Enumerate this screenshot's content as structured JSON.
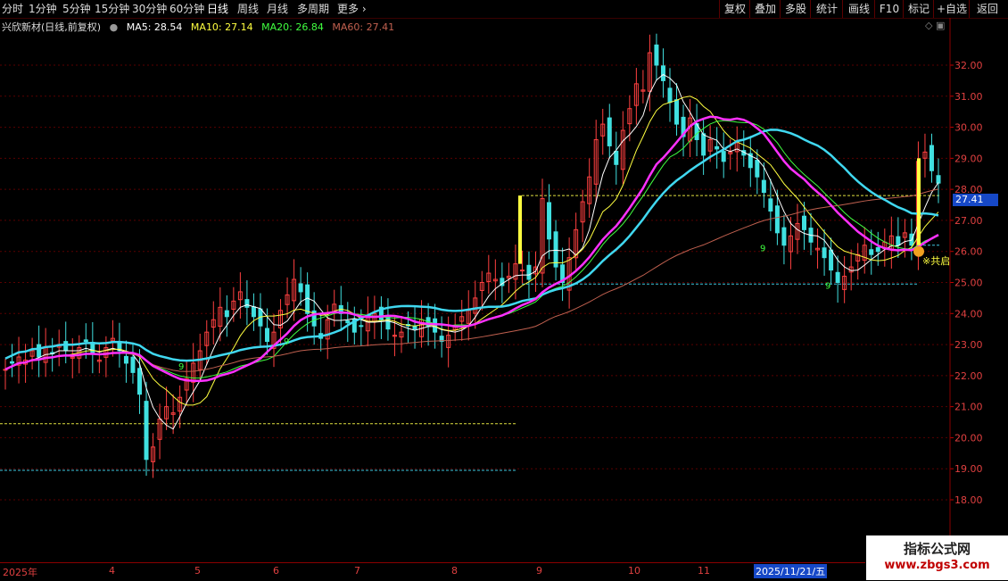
{
  "toolbar": {
    "periods": [
      "分时",
      "1分钟",
      "5分钟",
      "15分钟",
      "30分钟",
      "60分钟",
      "日线",
      "周线",
      "月线",
      "多周期",
      "更多"
    ],
    "active_period": "日线",
    "tools": [
      "复权",
      "叠加",
      "多股",
      "统计",
      "画线",
      "F10",
      "标记",
      "+自选",
      "返回"
    ]
  },
  "legend": {
    "title": "兴欣新材(日线,前复权)",
    "ma5": "MA5: 28.54",
    "ma10": "MA10: 27.14",
    "ma20": "MA20: 26.84",
    "ma60": "MA60: 27.41"
  },
  "current_price_tag": "27.41",
  "signal_label": "※共启",
  "countdown_label": "9",
  "date_axis": {
    "labels": [
      "2025年",
      "4",
      "5",
      "6",
      "7",
      "8",
      "9",
      "10",
      "11"
    ],
    "highlight": "2025/11/21/五"
  },
  "watermark": {
    "line1": "指标公式网",
    "line2": "www.zbgs3.com"
  },
  "colors": {
    "up": "#ff4040",
    "down": "#40e0e0",
    "ma5": "#ffffff",
    "ma10": "#ffff40",
    "ma20": "#40ff40",
    "ma60": "#c0604f",
    "cyan_band": "#40d8f0",
    "magenta_band": "#ff30ff"
  },
  "chart_data": {
    "type": "candlestick",
    "yticks": [
      18.0,
      19.0,
      20.0,
      21.0,
      22.0,
      23.0,
      24.0,
      25.0,
      26.0,
      27.0,
      28.0,
      29.0,
      30.0,
      31.0,
      32.0
    ],
    "ylim": [
      17.6,
      33.0
    ],
    "months": [
      "2025-03",
      "2025-04",
      "2025-05",
      "2025-06",
      "2025-07",
      "2025-08",
      "2025-09",
      "2025-10",
      "2025-11"
    ],
    "closes": [
      22.2,
      22.4,
      22.6,
      22.5,
      22.8,
      22.6,
      22.9,
      22.7,
      23.0,
      22.8,
      22.6,
      22.9,
      23.1,
      22.7,
      22.5,
      22.9,
      23.2,
      22.8,
      22.4,
      22.1,
      21.4,
      19.3,
      19.7,
      20.6,
      21.0,
      20.8,
      21.3,
      21.9,
      22.4,
      22.8,
      23.4,
      23.8,
      24.2,
      23.9,
      24.4,
      24.7,
      24.2,
      23.9,
      23.6,
      23.1,
      23.4,
      24.1,
      24.6,
      25.1,
      24.7,
      24.0,
      23.6,
      23.2,
      23.8,
      24.3,
      24.0,
      23.7,
      23.4,
      23.6,
      23.9,
      24.0,
      23.8,
      23.5,
      23.3,
      23.4,
      23.6,
      23.5,
      23.8,
      23.6,
      23.4,
      23.1,
      23.3,
      23.6,
      23.9,
      24.1,
      24.5,
      25.0,
      25.3,
      25.1,
      24.9,
      25.2,
      25.6,
      25.4,
      25.1,
      25.5,
      27.7,
      26.4,
      25.5,
      25.0,
      25.8,
      26.7,
      27.6,
      28.4,
      29.6,
      30.1,
      29.4,
      28.8,
      29.9,
      30.6,
      31.4,
      31.2,
      32.4,
      32.0,
      31.5,
      30.8,
      30.1,
      29.7,
      30.3,
      29.6,
      29.1,
      29.6,
      29.3,
      28.9,
      29.2,
      29.5,
      29.1,
      28.7,
      28.4,
      27.9,
      27.3,
      26.6,
      26.2,
      26.5,
      26.9,
      26.7,
      26.3,
      26.1,
      25.8,
      25.4,
      25.0,
      25.2,
      25.5,
      25.9,
      26.2,
      25.9,
      26.0,
      26.3,
      26.5,
      26.2,
      26.6,
      26.2,
      28.9,
      29.2,
      28.6,
      28.2
    ]
  }
}
